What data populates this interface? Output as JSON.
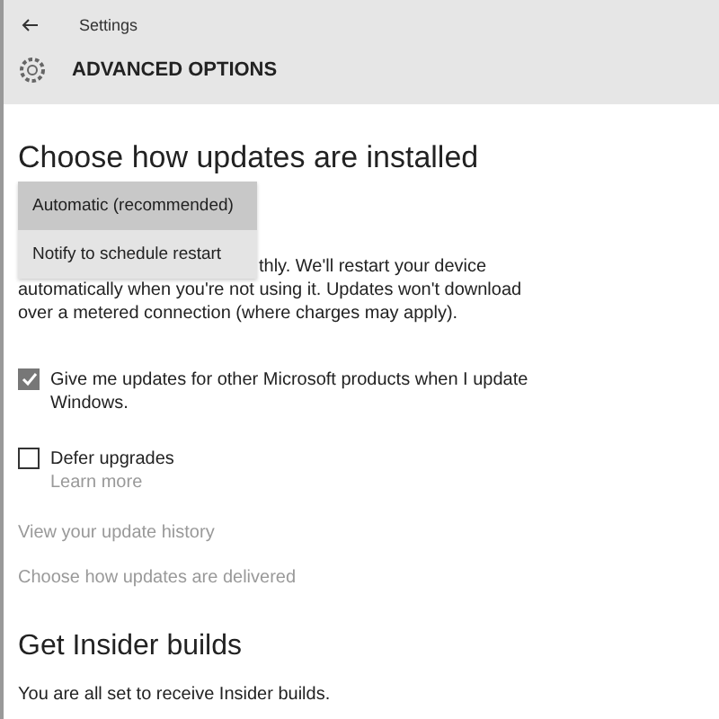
{
  "window": {
    "title": "Settings"
  },
  "header": {
    "title": "ADVANCED OPTIONS"
  },
  "section": {
    "heading": "Choose how updates are installed"
  },
  "dropdown": {
    "options": [
      {
        "label": "Automatic (recommended)",
        "selected": true
      },
      {
        "label": "Notify to schedule restart",
        "selected": false
      }
    ]
  },
  "description": [
    "thly. We'll restart your device",
    "automatically when you're not using it. Updates won't download over a metered connection (where charges may apply)."
  ],
  "checkboxes": [
    {
      "label": "Give me updates for other Microsoft products when I update Windows.",
      "checked": true
    },
    {
      "label": "Defer upgrades",
      "checked": false,
      "link": "Learn more"
    }
  ],
  "links": [
    "View your update history",
    "Choose how updates are delivered"
  ],
  "insider": {
    "heading": "Get Insider builds",
    "text": "You are all set to receive Insider builds."
  }
}
